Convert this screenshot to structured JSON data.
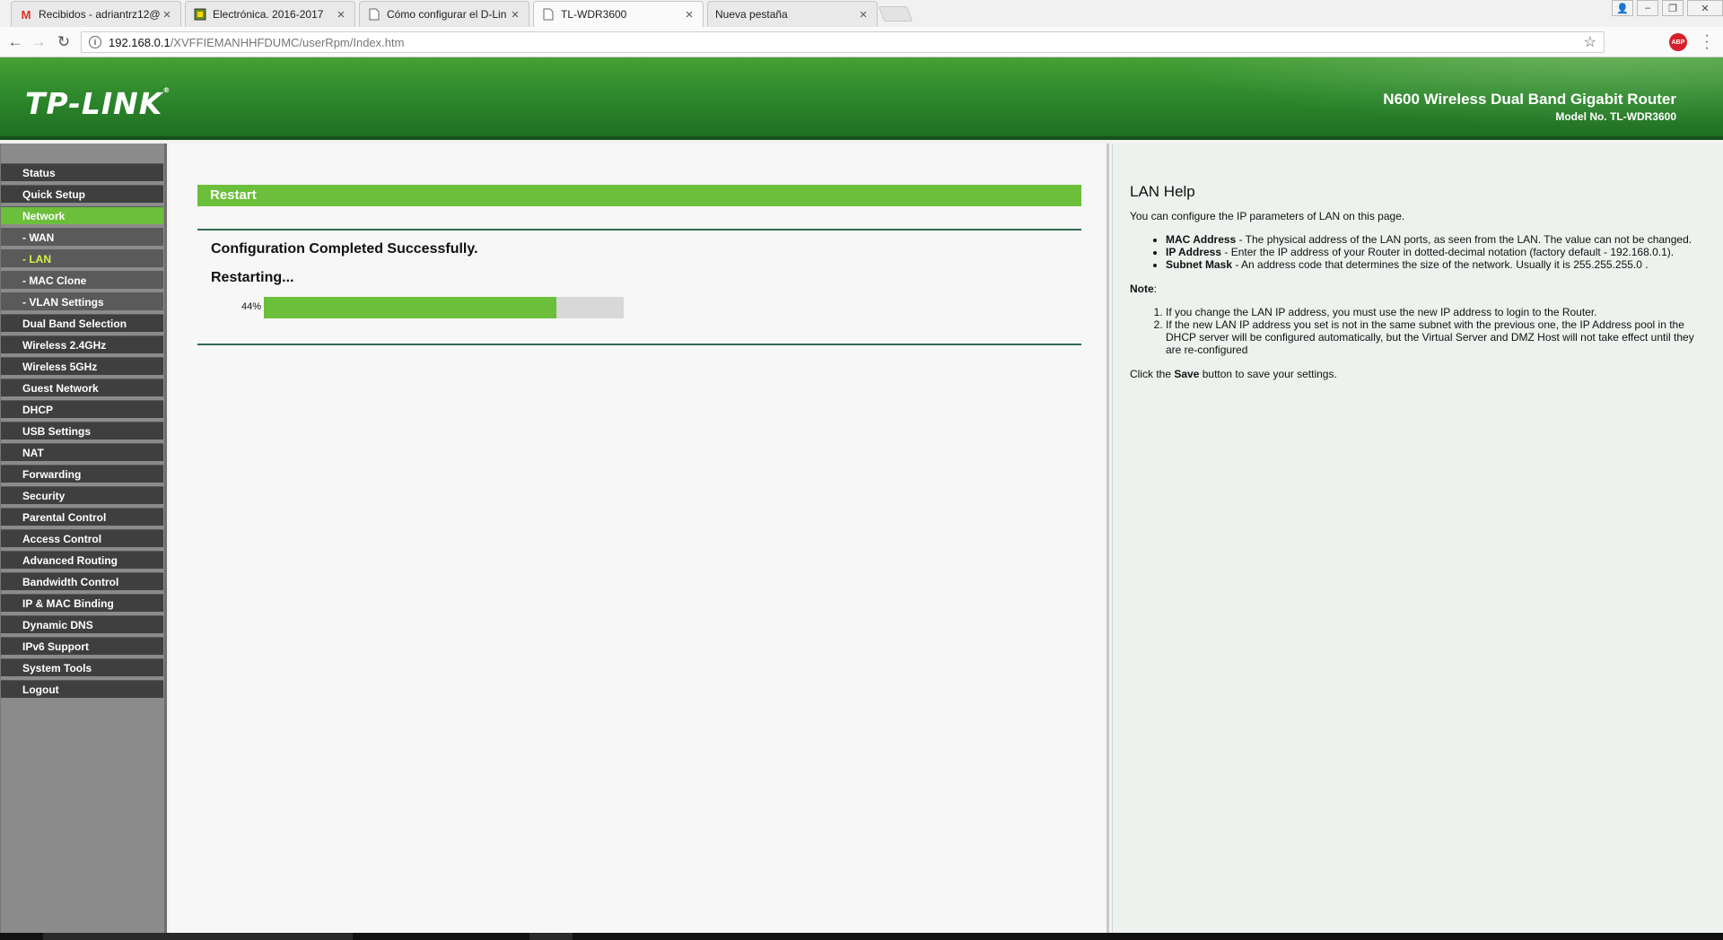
{
  "browser": {
    "tabs": [
      {
        "title": "Recibidos - adriantrz12@",
        "icon": "gmail-icon"
      },
      {
        "title": "Electrónica. 2016-2017",
        "icon": "green-square-icon"
      },
      {
        "title": "Cómo configurar el D-Lin",
        "icon": "page-icon"
      },
      {
        "title": "TL-WDR3600",
        "icon": "page-icon"
      },
      {
        "title": "Nueva pestaña",
        "icon": ""
      }
    ],
    "url_host": "192.168.0.1",
    "url_path": "/XVFFIEMANHHFDUMC/userRpm/Index.htm",
    "extension_label": "ABP"
  },
  "header": {
    "logo": "TP-LINK",
    "product": "N600 Wireless Dual Band Gigabit Router",
    "model": "Model No. TL-WDR3600"
  },
  "sidebar": {
    "items": [
      {
        "label": "Status"
      },
      {
        "label": "Quick Setup"
      },
      {
        "label": "Network"
      },
      {
        "label": "- WAN"
      },
      {
        "label": "- LAN"
      },
      {
        "label": "- MAC Clone"
      },
      {
        "label": "- VLAN Settings"
      },
      {
        "label": "Dual Band Selection"
      },
      {
        "label": "Wireless 2.4GHz"
      },
      {
        "label": "Wireless 5GHz"
      },
      {
        "label": "Guest Network"
      },
      {
        "label": "DHCP"
      },
      {
        "label": "USB Settings"
      },
      {
        "label": "NAT"
      },
      {
        "label": "Forwarding"
      },
      {
        "label": "Security"
      },
      {
        "label": "Parental Control"
      },
      {
        "label": "Access Control"
      },
      {
        "label": "Advanced Routing"
      },
      {
        "label": "Bandwidth Control"
      },
      {
        "label": "IP & MAC Binding"
      },
      {
        "label": "Dynamic DNS"
      },
      {
        "label": "IPv6 Support"
      },
      {
        "label": "System Tools"
      },
      {
        "label": "Logout"
      }
    ]
  },
  "main": {
    "title": "Restart",
    "message": "Configuration Completed Successfully.",
    "status": "Restarting...",
    "progress_label": "44%",
    "progress": 0.44,
    "accent": "#6cbf3a"
  },
  "help": {
    "title": "LAN Help",
    "intro": "You can configure the IP parameters of LAN on this page.",
    "items": [
      {
        "term": "MAC Address",
        "text": " - The physical address of the LAN ports, as seen from the LAN. The value can not be changed."
      },
      {
        "term": "IP Address",
        "text": " - Enter the IP address of your Router in dotted-decimal notation (factory default - 192.168.0.1)."
      },
      {
        "term": "Subnet Mask",
        "text": " - An address code that determines the size of the network. Usually it is 255.255.255.0 ."
      }
    ],
    "note_label": "Note",
    "notes": [
      "If you change the LAN IP address, you must use the new IP address to login to the Router.",
      "If the new LAN IP address you set is not in the same subnet with the previous one, the IP Address pool in the DHCP server will be configured automatically, but the Virtual Server and DMZ Host will not take effect until they are re-configured"
    ],
    "save_pre": "Click the ",
    "save_word": "Save",
    "save_post": " button to save your settings."
  }
}
